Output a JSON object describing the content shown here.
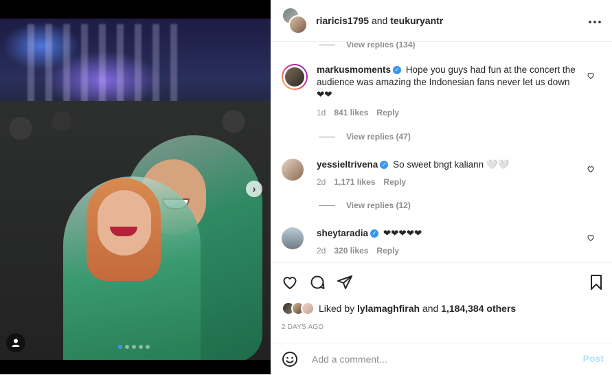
{
  "post": {
    "carousel_dots": 5,
    "active_dot": 0
  },
  "header": {
    "user1": "riaricis1795",
    "joiner": "and",
    "user2": "teukuryantr",
    "more_icon": "more-horizontal-icon"
  },
  "comments": {
    "prev_view_replies": "View replies (134)",
    "items": [
      {
        "username": "markusmoments",
        "verified": true,
        "text": "Hope you guys had fun at the concert the audience was amazing the Indonesian fans never let us down ❤❤",
        "time": "1d",
        "likes": "841 likes",
        "reply": "Reply",
        "view_replies": "View replies (47)"
      },
      {
        "username": "yessieltrivena",
        "verified": true,
        "text": "So sweet bngt kaliann 🤍🤍",
        "time": "2d",
        "likes": "1,171 likes",
        "reply": "Reply",
        "view_replies": "View replies (12)"
      },
      {
        "username": "sheytaradia",
        "verified": true,
        "text": "❤❤❤❤❤",
        "time": "2d",
        "likes": "320 likes",
        "reply": "Reply"
      }
    ]
  },
  "actions": {
    "liked_by_prefix": "Liked by",
    "liked_by_user": "lylamaghfirah",
    "liked_by_and": "and",
    "liked_by_count": "1,184,384 others",
    "time_ago": "2 DAYS AGO"
  },
  "add_comment": {
    "placeholder": "Add a comment...",
    "post_label": "Post"
  },
  "colors": {
    "verified": "#3897f0",
    "post_disabled": "#b2dffc",
    "muted": "#8e8e8e"
  }
}
